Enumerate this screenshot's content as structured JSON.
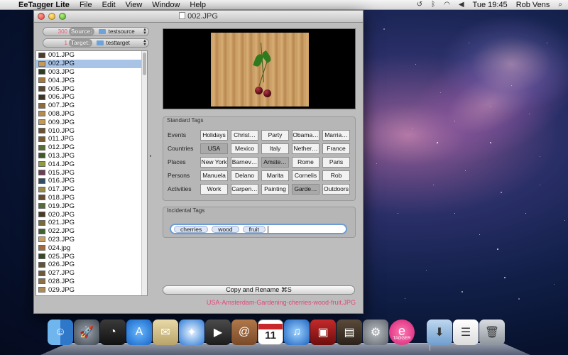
{
  "menubar": {
    "apple": "",
    "app_name": "EeTagger Lite",
    "menus": [
      "File",
      "Edit",
      "View",
      "Window",
      "Help"
    ],
    "clock": "Tue 19:45",
    "user": "Rob Vens"
  },
  "window": {
    "title": "002.JPG"
  },
  "source": {
    "count": "300",
    "label": "Source:",
    "folder": "testsource"
  },
  "target": {
    "count": "1",
    "label": "Target:",
    "folder": "testtarget"
  },
  "files": [
    "001.JPG",
    "002.JPG",
    "003.JPG",
    "004.JPG",
    "005.JPG",
    "006.JPG",
    "007.JPG",
    "008.JPG",
    "009.JPG",
    "010.JPG",
    "011.JPG",
    "012.JPG",
    "013.JPG",
    "014.JPG",
    "015.JPG",
    "016.JPG",
    "017.JPG",
    "018.JPG",
    "019.JPG",
    "020.JPG",
    "021.JPG",
    "022.JPG",
    "023.JPG",
    "024.jpg",
    "025.JPG",
    "026.JPG",
    "027.JPG",
    "028.JPG",
    "029.JPG"
  ],
  "selected_file": "002.JPG",
  "standard_tags": {
    "title": "Standard Tags",
    "rows": [
      {
        "category": "Events",
        "tags": [
          "Holidays",
          "Christ…",
          "Party",
          "Obama…",
          "Marria…"
        ],
        "selected": []
      },
      {
        "category": "Countries",
        "tags": [
          "USA",
          "Mexico",
          "Italy",
          "Nether…",
          "France"
        ],
        "selected": [
          "USA"
        ]
      },
      {
        "category": "Places",
        "tags": [
          "New York",
          "Barnev…",
          "Amste…",
          "Rome",
          "Paris"
        ],
        "selected": [
          "Amste…"
        ]
      },
      {
        "category": "Persons",
        "tags": [
          "Manuela",
          "Delano",
          "Marita",
          "Cornelis",
          "Rob"
        ],
        "selected": []
      },
      {
        "category": "Activities",
        "tags": [
          "Work",
          "Carpen…",
          "Painting",
          "Garde…",
          "Outdoors"
        ],
        "selected": [
          "Garde…"
        ]
      }
    ]
  },
  "incidental_tags": {
    "title": "Incidental Tags",
    "tokens": [
      "cherries",
      "wood",
      "fruit"
    ]
  },
  "copy_button": "Copy and Rename ⌘S",
  "result_filename": "USA-Amsterdam-Gardening-cherries-wood-fruit.JPG",
  "dock": {
    "items": [
      "finder-icon",
      "launchpad-icon",
      "dashboard-icon",
      "app-store-icon",
      "mail-stamp-icon",
      "safari-icon",
      "facetime-icon",
      "address-book-icon",
      "ical-icon",
      "itunes-icon",
      "photo-booth-icon",
      "iphoto-icon",
      "system-preferences-icon",
      "eetagger-icon",
      "downloads-folder-icon",
      "document-icon",
      "trash-icon"
    ],
    "ical_date": "11",
    "eetagger_label": "TAGGER"
  },
  "colors": {
    "accent_pink": "#e0477a",
    "selection_blue": "#a9c3e6"
  }
}
